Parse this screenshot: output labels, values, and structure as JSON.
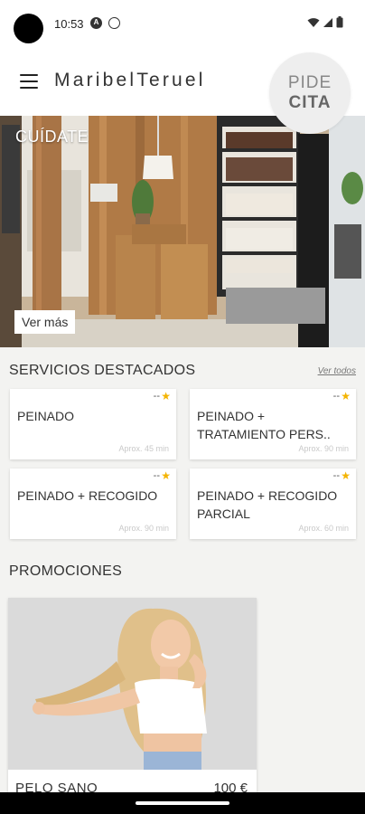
{
  "status": {
    "time": "10:53",
    "icon_a": "A",
    "icon_b": "⊖"
  },
  "header": {
    "brand": "MaribelTeruel",
    "cta_line1": "PIDE",
    "cta_line2": "CITA"
  },
  "hero": {
    "title": "CUÍDATE",
    "button": "Ver más"
  },
  "featured": {
    "title": "SERVICIOS DESTACADOS",
    "see_all": "Ver todos",
    "items": [
      {
        "name": "PEINADO",
        "dots": "--",
        "time": "Aprox. 45 min"
      },
      {
        "name": "PEINADO + TRATAMIENTO PERS..",
        "dots": "--",
        "time": "Aprox. 90 min"
      },
      {
        "name": "PEINADO + RECOGIDO",
        "dots": "--",
        "time": "Aprox. 90 min"
      },
      {
        "name": "PEINADO + RECOGIDO PARCIAL",
        "dots": "--",
        "time": "Aprox. 60 min"
      }
    ]
  },
  "promotions": {
    "title": "PROMOCIONES",
    "items": [
      {
        "name": "PELO SANO",
        "price": "100 €"
      }
    ]
  },
  "colors": {
    "star": "#f4b400",
    "content_bg": "#f3f3f1",
    "wood": "#a0703f"
  },
  "icons": [
    "menu-icon",
    "star-icon",
    "wifi-icon",
    "signal-icon",
    "battery-icon"
  ]
}
